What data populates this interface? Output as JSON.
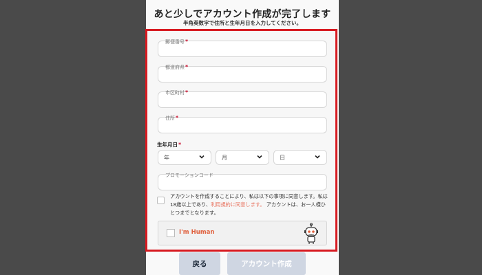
{
  "header": {
    "title": "あと少しでアカウント作成が完了します",
    "subtitle": "半角英数字で住所と生年月日を入力してください。"
  },
  "fields": {
    "postal_code": {
      "label": "郵便番号",
      "value": ""
    },
    "prefecture": {
      "label": "都道府県",
      "value": ""
    },
    "city": {
      "label": "市区町村",
      "value": ""
    },
    "address": {
      "label": "住所",
      "value": ""
    },
    "required_mark": "*"
  },
  "birthdate": {
    "label": "生年月日",
    "year": "年",
    "month": "月",
    "day": "日"
  },
  "promo": {
    "label": "プロモーションコード",
    "value": ""
  },
  "agreement": {
    "text_1": "アカウントを作成することにより、私は以下の事項に同意します。私は18歳以上であり、",
    "link": "利用規約に同意します。",
    "text_2": " アカウントは、お一人様ひとつまでとなります。",
    "checked": false
  },
  "captcha": {
    "label": "I'm Human",
    "checked": false,
    "icon": "robot-icon"
  },
  "buttons": {
    "back": "戻る",
    "create": "アカウント作成"
  },
  "colors": {
    "highlight_border": "#d71920",
    "link": "#e8735f",
    "captcha_text": "#e0603d",
    "button_bg": "#cfd6e2"
  }
}
